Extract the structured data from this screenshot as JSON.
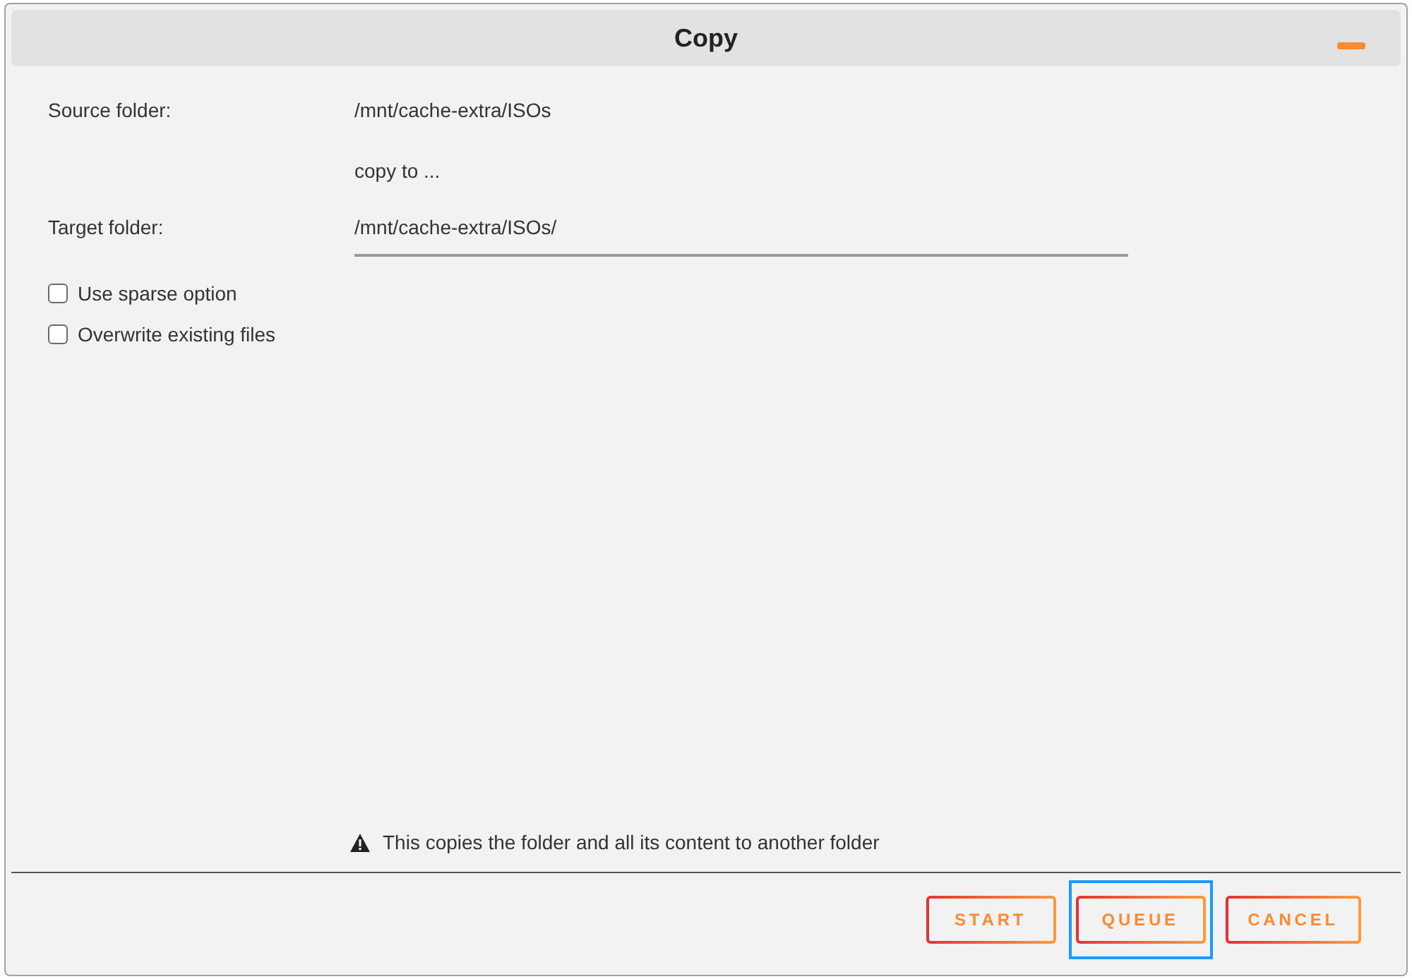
{
  "window": {
    "title": "Copy"
  },
  "fields": [
    {
      "kind": "text",
      "label": "Source folder:",
      "value": "/mnt/cache-extra/ISOs"
    },
    {
      "kind": "note",
      "value": "copy to ..."
    },
    {
      "kind": "input",
      "label": "Target folder:",
      "value": "/mnt/cache-extra/ISOs/"
    }
  ],
  "options": [
    {
      "label": "Use sparse option",
      "checked": false
    },
    {
      "label": "Overwrite existing files",
      "checked": false
    }
  ],
  "notice": {
    "text": "This copies the folder and all its content to another folder"
  },
  "buttons": [
    {
      "label": "START",
      "focused": false
    },
    {
      "label": "QUEUE",
      "focused": true
    },
    {
      "label": "CANCEL",
      "focused": false
    }
  ]
}
